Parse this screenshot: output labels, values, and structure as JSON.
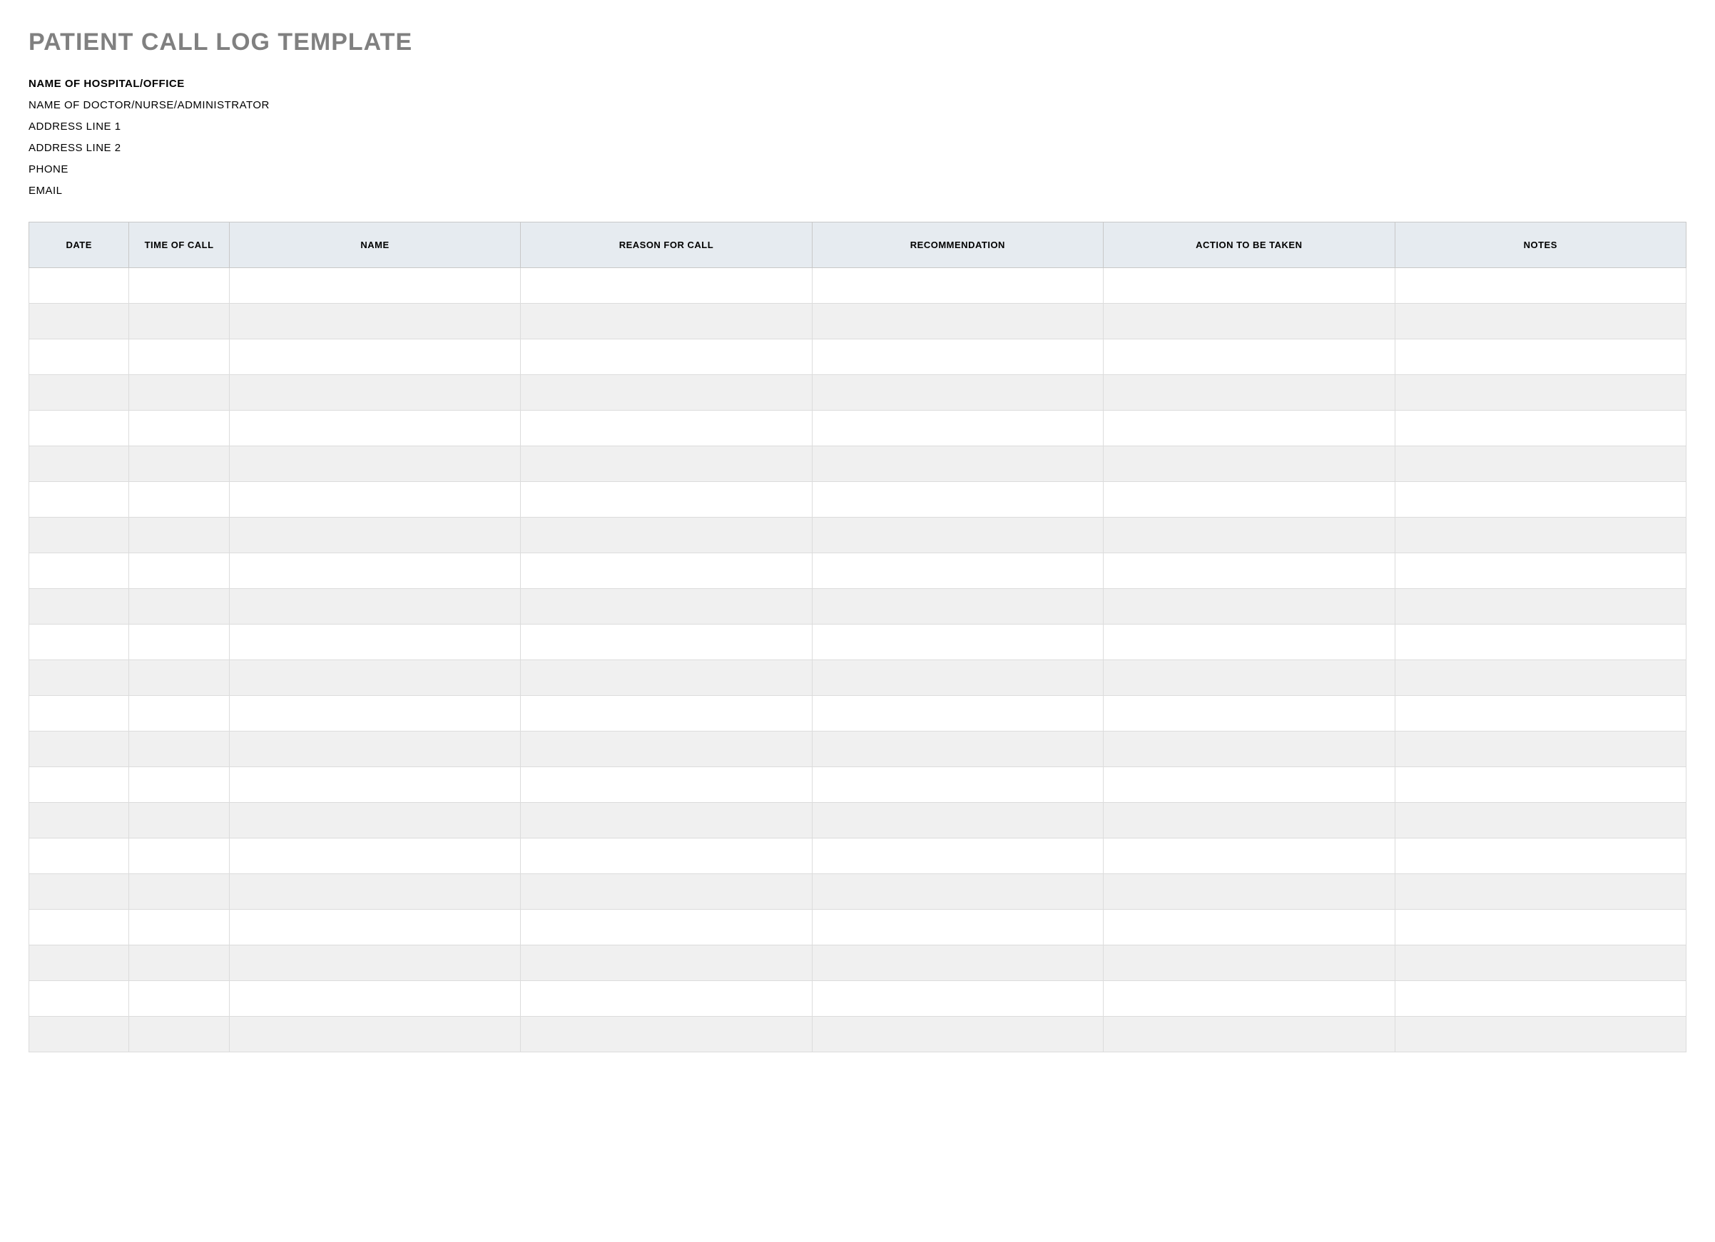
{
  "title": "PATIENT CALL LOG TEMPLATE",
  "info": {
    "hospital": "NAME OF HOSPITAL/OFFICE",
    "doctor": "NAME OF DOCTOR/NURSE/ADMINISTRATOR",
    "address1": "ADDRESS LINE 1",
    "address2": "ADDRESS LINE 2",
    "phone": "PHONE",
    "email": "EMAIL"
  },
  "columns": [
    "DATE",
    "TIME OF CALL",
    "NAME",
    "REASON FOR CALL",
    "RECOMMENDATION",
    "ACTION TO BE TAKEN",
    "NOTES"
  ],
  "rows": [
    [
      "",
      "",
      "",
      "",
      "",
      "",
      ""
    ],
    [
      "",
      "",
      "",
      "",
      "",
      "",
      ""
    ],
    [
      "",
      "",
      "",
      "",
      "",
      "",
      ""
    ],
    [
      "",
      "",
      "",
      "",
      "",
      "",
      ""
    ],
    [
      "",
      "",
      "",
      "",
      "",
      "",
      ""
    ],
    [
      "",
      "",
      "",
      "",
      "",
      "",
      ""
    ],
    [
      "",
      "",
      "",
      "",
      "",
      "",
      ""
    ],
    [
      "",
      "",
      "",
      "",
      "",
      "",
      ""
    ],
    [
      "",
      "",
      "",
      "",
      "",
      "",
      ""
    ],
    [
      "",
      "",
      "",
      "",
      "",
      "",
      ""
    ],
    [
      "",
      "",
      "",
      "",
      "",
      "",
      ""
    ],
    [
      "",
      "",
      "",
      "",
      "",
      "",
      ""
    ],
    [
      "",
      "",
      "",
      "",
      "",
      "",
      ""
    ],
    [
      "",
      "",
      "",
      "",
      "",
      "",
      ""
    ],
    [
      "",
      "",
      "",
      "",
      "",
      "",
      ""
    ],
    [
      "",
      "",
      "",
      "",
      "",
      "",
      ""
    ],
    [
      "",
      "",
      "",
      "",
      "",
      "",
      ""
    ],
    [
      "",
      "",
      "",
      "",
      "",
      "",
      ""
    ],
    [
      "",
      "",
      "",
      "",
      "",
      "",
      ""
    ],
    [
      "",
      "",
      "",
      "",
      "",
      "",
      ""
    ],
    [
      "",
      "",
      "",
      "",
      "",
      "",
      ""
    ],
    [
      "",
      "",
      "",
      "",
      "",
      "",
      ""
    ]
  ]
}
